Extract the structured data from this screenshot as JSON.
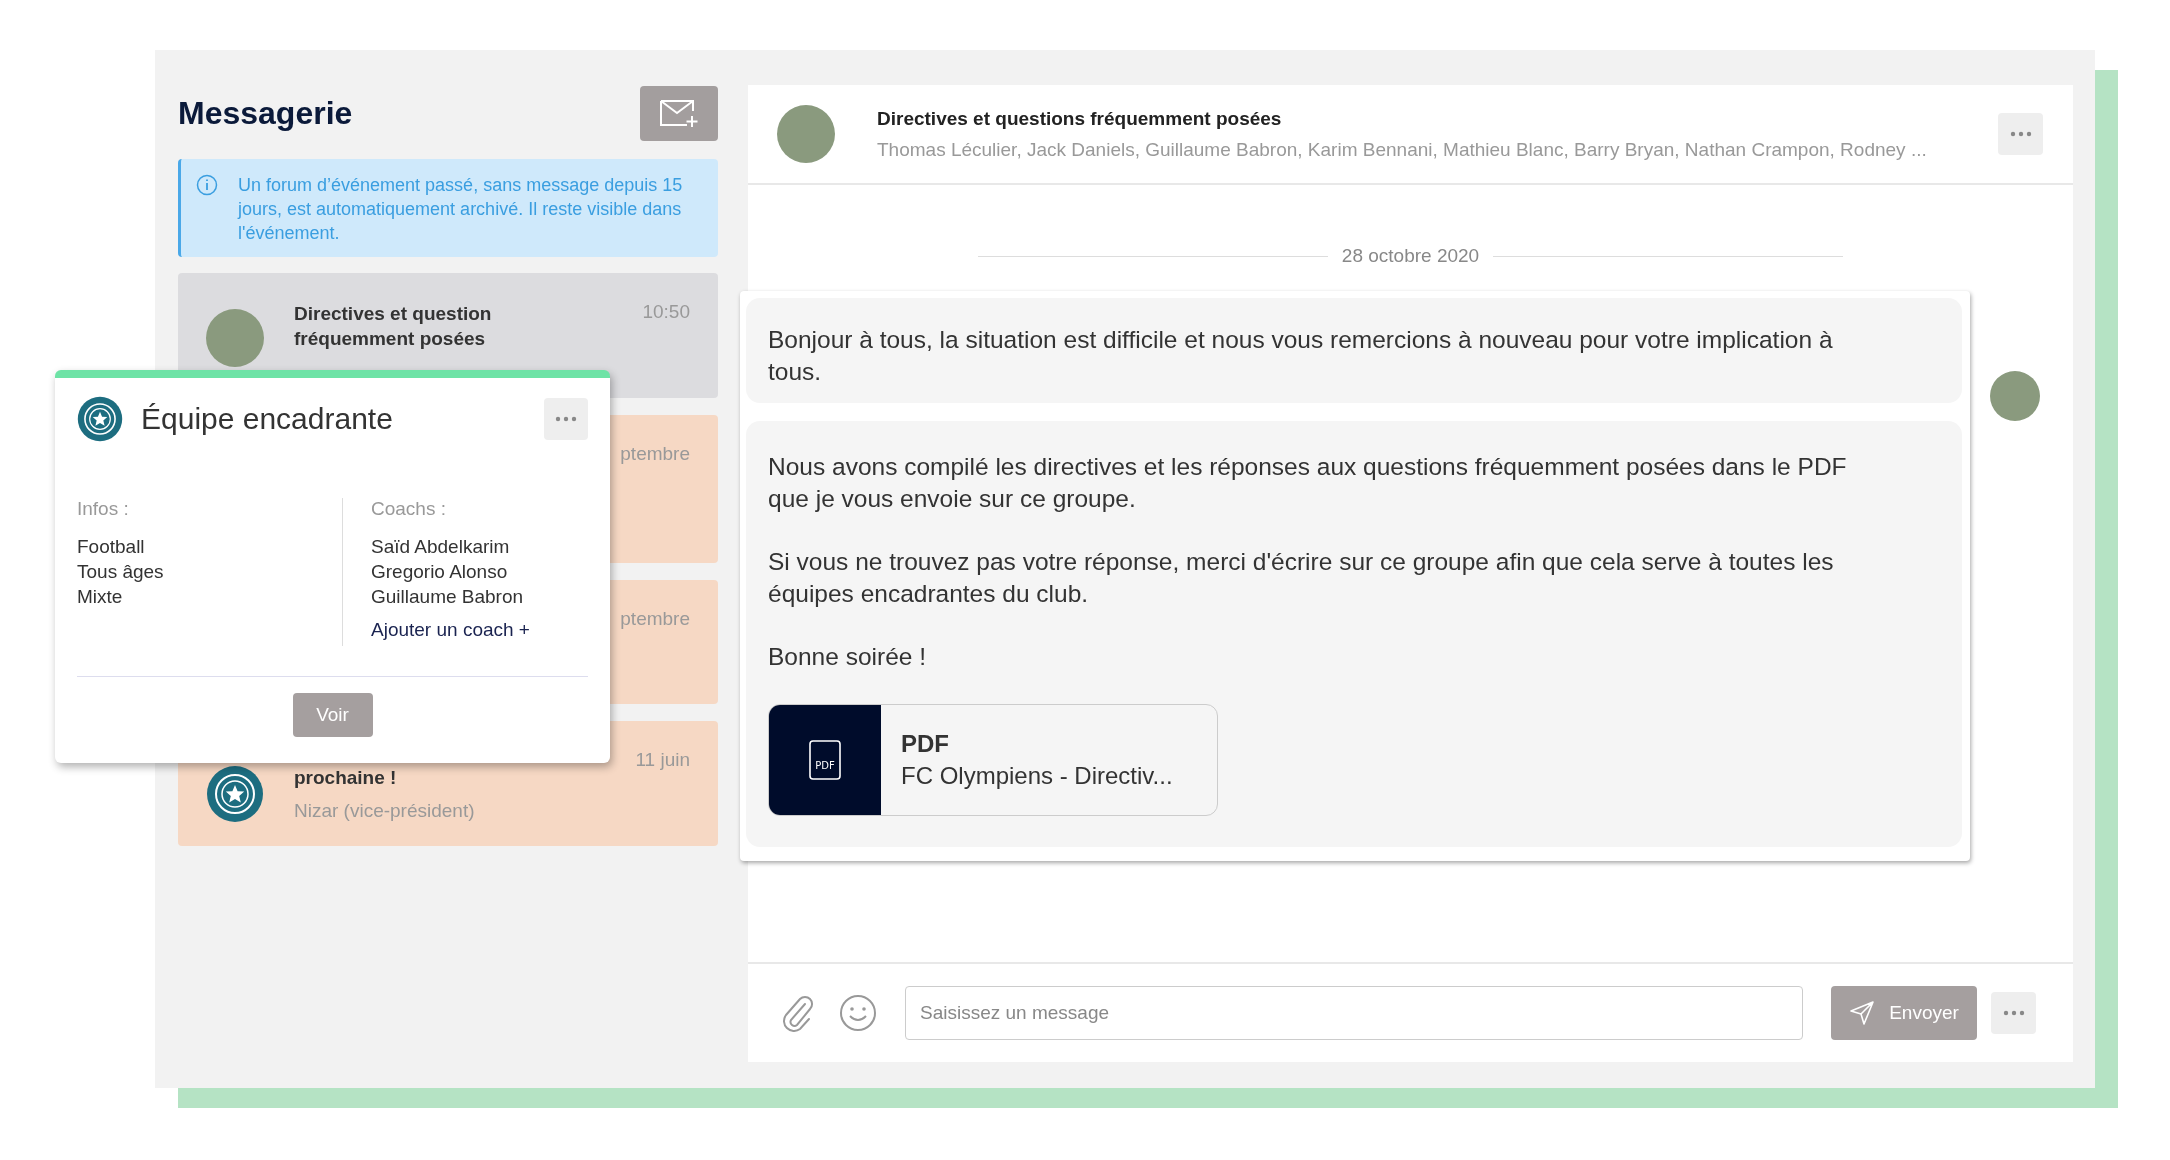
{
  "sidebar": {
    "title": "Messagerie",
    "info": "Un forum d’événement passé, sans message depuis 15 jours, est automatiquement archivé. Il reste visible dans l'événement.",
    "conversations": [
      {
        "title": "Directives et question fréquemment posées",
        "time": "10:50",
        "selected": true,
        "kind": "photo"
      },
      {
        "time": "ptembre",
        "selected": false
      },
      {
        "time": "ptembre",
        "selected": false
      },
      {
        "title": "prochaine !",
        "time": "11 juin",
        "sender": "Nizar (vice-président)",
        "selected": false,
        "kind": "logo"
      }
    ]
  },
  "popup": {
    "title": "Équipe encadrante",
    "infos_label": "Infos :",
    "infos": [
      "Football",
      "Tous âges",
      "Mixte"
    ],
    "coachs_label": "Coachs :",
    "coachs": [
      "Saïd Abdelkarim",
      "Gregorio Alonso",
      "Guillaume Babron"
    ],
    "add_coach": "Ajouter un coach +",
    "button": "Voir"
  },
  "conversation": {
    "title": "Directives et questions fréquemment posées",
    "participants": "Thomas Léculier, Jack Daniels, Guillaume Babron, Karim Bennani, Mathieu Blanc, Barry Bryan, Nathan Crampon, Rodney ...",
    "date": "28 octobre 2020",
    "messages": [
      {
        "paragraphs": [
          "Bonjour à tous, la situation est difficile et nous vous remercions à nouveau pour votre implication à tous."
        ]
      },
      {
        "paragraphs": [
          "Nous avons compilé les directives et les réponses aux questions fréquemment posées dans le PDF que je vous envoie sur ce groupe.",
          "Si vous ne trouvez pas votre réponse, merci d'écrire sur ce groupe afin que cela serve à toutes les équipes encadrantes du club.",
          "Bonne soirée !"
        ],
        "attachment": {
          "icon_label": "PDF",
          "type": "PDF",
          "name": "FC Olympiens - Directiv..."
        }
      }
    ]
  },
  "composer": {
    "placeholder": "Saisissez un message",
    "send": "Envoyer"
  }
}
